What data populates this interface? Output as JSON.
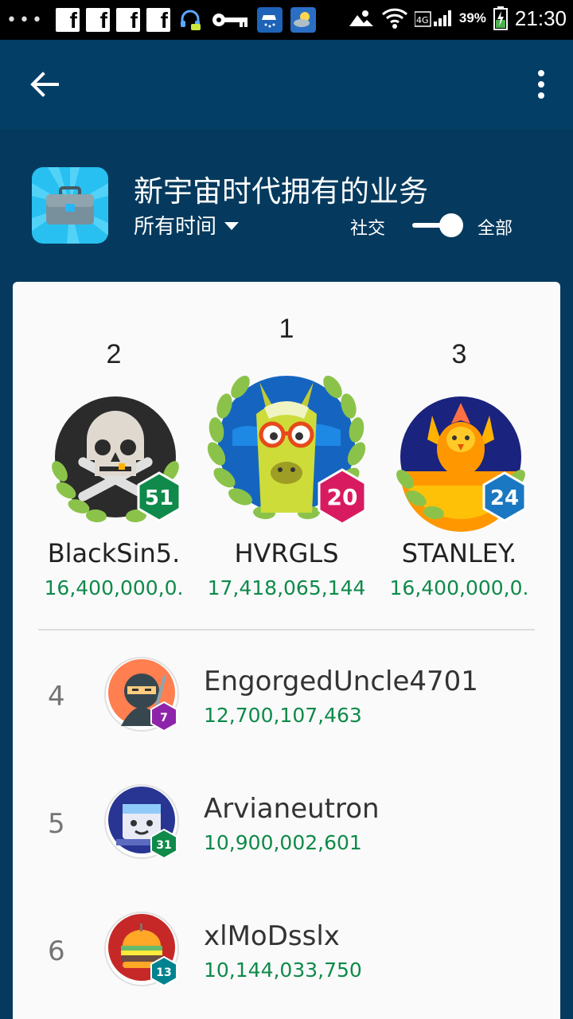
{
  "status_bar": {
    "battery_percent": "39%",
    "time": "21:30",
    "network": "4G"
  },
  "app_bar": {
    "back_icon": "arrow-back-icon",
    "menu_icon": "more-vert-icon"
  },
  "header": {
    "title": "新宇宙时代拥有的业务",
    "time_filter": "所有时间",
    "toggle_left_label": "社交",
    "toggle_right_label": "全部",
    "toggle_on": true,
    "game_icon": "briefcase-icon"
  },
  "podium": [
    {
      "rank": "2",
      "name": "BlackSin5.",
      "score": "16,400,000,0.",
      "level": "51",
      "level_color": "#0f8a4a",
      "avatar": "skull-avatar"
    },
    {
      "rank": "1",
      "name": "HVRGLS",
      "score": "17,418,065,144",
      "level": "20",
      "level_color": "#d81b60",
      "avatar": "llama-avatar"
    },
    {
      "rank": "3",
      "name": "STANLEY.",
      "score": "16,400,000,0.",
      "level": "24",
      "level_color": "#1a78c2",
      "avatar": "phoenix-avatar"
    }
  ],
  "list": [
    {
      "rank": "4",
      "name": "EngorgedUncle4701",
      "score": "12,700,107,463",
      "level": "7",
      "level_color": "#8e24aa",
      "avatar": "ninja-avatar"
    },
    {
      "rank": "5",
      "name": "Arvianeutron",
      "score": "10,900,002,601",
      "level": "31",
      "level_color": "#0f8a4a",
      "avatar": "robot-avatar"
    },
    {
      "rank": "6",
      "name": "xlMoDsslx",
      "score": "10,144,033,750",
      "level": "13",
      "level_color": "#00838f",
      "avatar": "burger-avatar"
    }
  ],
  "colors": {
    "app_bar": "#023e66",
    "background": "#053a5e",
    "score_green": "#0f8a4a"
  }
}
